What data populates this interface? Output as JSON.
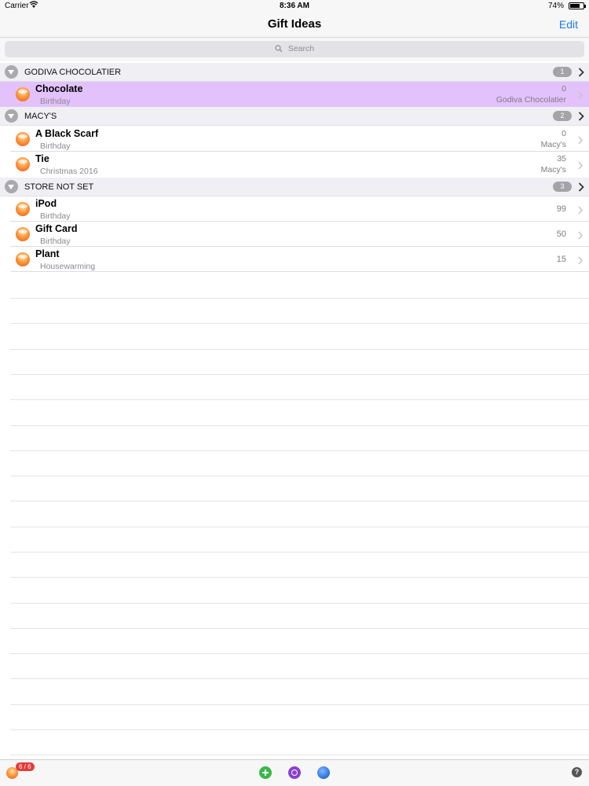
{
  "status_bar": {
    "carrier": "Carrier",
    "time": "8:36 AM",
    "battery_percent": "74%",
    "battery_level": 0.74
  },
  "nav": {
    "title": "Gift Ideas",
    "edit_label": "Edit"
  },
  "search": {
    "placeholder": "Search"
  },
  "sections": [
    {
      "name": "GODIVA CHOCOLATIER",
      "count": "1",
      "rows": [
        {
          "title": "Chocolate",
          "subtitle": "Birthday",
          "value": "0",
          "store": "Godiva Chocolatier",
          "selected": true
        }
      ]
    },
    {
      "name": "MACY'S",
      "count": "2",
      "rows": [
        {
          "title": "A Black Scarf",
          "subtitle": "Birthday",
          "value": "0",
          "store": "Macy's"
        },
        {
          "title": "Tie",
          "subtitle": "Christmas 2016",
          "value": "35",
          "store": "Macy's"
        }
      ]
    },
    {
      "name": "STORE NOT SET",
      "count": "3",
      "rows": [
        {
          "title": "iPod",
          "subtitle": "Birthday",
          "value": "99",
          "store": ""
        },
        {
          "title": "Gift Card",
          "subtitle": "Birthday",
          "value": "50",
          "store": ""
        },
        {
          "title": "Plant",
          "subtitle": "Housewarming",
          "value": "15",
          "store": ""
        }
      ]
    }
  ],
  "toolbar": {
    "badge": "6 / 6",
    "help_label": "?",
    "icons": [
      "gift-orb-icon",
      "add-icon",
      "target-icon",
      "globe-icon",
      "help-icon"
    ]
  },
  "colors": {
    "accent": "#1a7cf2",
    "selected_row": "#e3c1fb",
    "section_bg": "#efeff4",
    "badge_red": "#e23b3b"
  }
}
